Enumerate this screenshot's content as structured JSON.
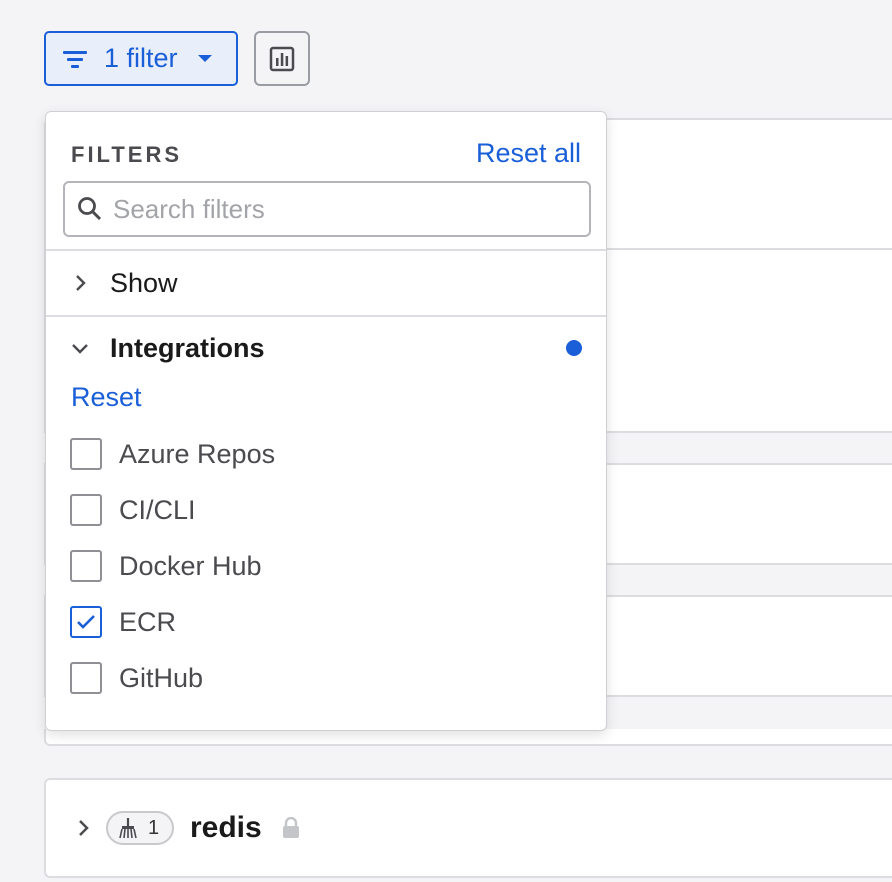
{
  "toolbar": {
    "filter_button_label": "1 filter",
    "chart_button": "chart-icon"
  },
  "filters": {
    "title": "FILTERS",
    "reset_all": "Reset all",
    "search_placeholder": "Search filters",
    "sections": [
      {
        "label": "Show",
        "expanded": false
      },
      {
        "label": "Integrations",
        "expanded": true,
        "has_active": true
      }
    ],
    "integrations": {
      "reset": "Reset",
      "options": [
        {
          "label": "Azure Repos",
          "checked": false
        },
        {
          "label": "CI/CLI",
          "checked": false
        },
        {
          "label": "Docker Hub",
          "checked": false
        },
        {
          "label": "ECR",
          "checked": true
        },
        {
          "label": "GitHub",
          "checked": false
        }
      ]
    }
  },
  "projects": [
    {
      "name": "redis",
      "count": "1",
      "locked": true
    }
  ],
  "colors": {
    "accent": "#1a5fd8",
    "border": "#dcdde1",
    "background": "#f4f4f6"
  }
}
